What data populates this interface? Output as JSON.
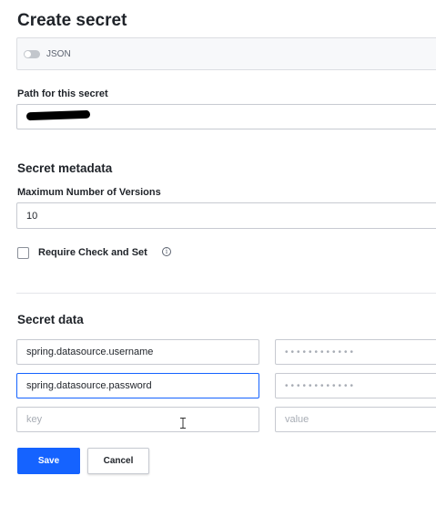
{
  "page": {
    "title": "Create secret"
  },
  "json_toggle": {
    "label": "JSON",
    "enabled": false
  },
  "path": {
    "label": "Path for this secret",
    "value": "",
    "value_redacted": true
  },
  "metadata": {
    "title": "Secret metadata",
    "max_versions_label": "Maximum Number of Versions",
    "max_versions_value": "10",
    "cas_label": "Require Check and Set",
    "cas_checked": false,
    "info_glyph": "i"
  },
  "secret_data": {
    "title": "Secret data",
    "rows": [
      {
        "key": "spring.datasource.username",
        "value": "••••••••••••"
      },
      {
        "key": "spring.datasource.password",
        "value": "••••••••••••"
      }
    ],
    "new_row": {
      "key_placeholder": "key",
      "value_placeholder": "value"
    }
  },
  "actions": {
    "save_label": "Save",
    "cancel_label": "Cancel"
  },
  "colors": {
    "primary": "#1563ff",
    "text": "#1f2329",
    "border": "#c7cad1"
  }
}
